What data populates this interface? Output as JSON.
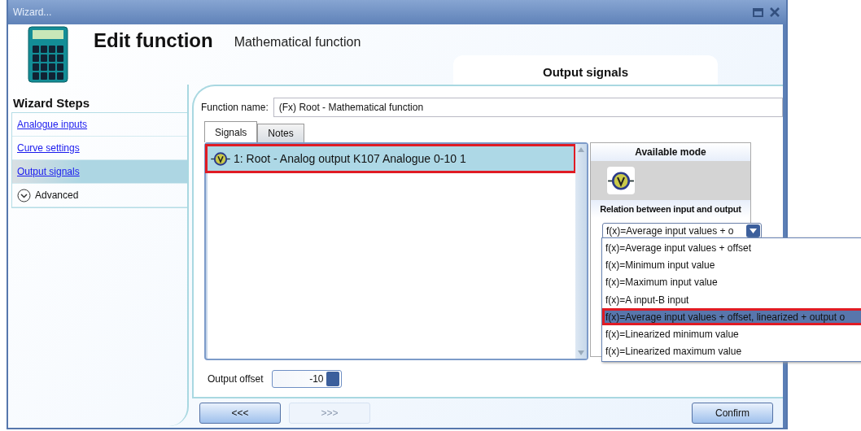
{
  "window": {
    "title": "Wizard..."
  },
  "header": {
    "title": "Edit function",
    "subtitle": "Mathematical function"
  },
  "step_tab": {
    "label": "Output signals"
  },
  "sidebar": {
    "title": "Wizard Steps",
    "items": [
      {
        "label": "Analogue inputs",
        "kind": "link",
        "selected": false
      },
      {
        "label": "Curve settings",
        "kind": "link",
        "selected": false
      },
      {
        "label": "Output signals",
        "kind": "link",
        "selected": true
      },
      {
        "label": "Advanced",
        "kind": "expander",
        "selected": false
      }
    ]
  },
  "function_name": {
    "label": "Function name:",
    "value": "(Fx) Root - Mathematical function"
  },
  "tabs": [
    {
      "label": "Signals",
      "selected": true
    },
    {
      "label": "Notes",
      "selected": false
    }
  ],
  "signals": [
    {
      "label": "1: Root - Analog output K107 Analogue 0-10 1",
      "selected": true,
      "highlighted": true
    }
  ],
  "mode_panel": {
    "title": "Available mode",
    "relation_label": "Relation between input and output",
    "dropdown": {
      "value": "f(x)=Average input values + o",
      "expanded": true,
      "options": [
        {
          "label": "f(x)=Average input values + offset",
          "selected": false,
          "highlighted": false
        },
        {
          "label": "f(x)=Minimum input value",
          "selected": false,
          "highlighted": false
        },
        {
          "label": "f(x)=Maximum input value",
          "selected": false,
          "highlighted": false
        },
        {
          "label": "f(x)=A input-B input",
          "selected": false,
          "highlighted": false
        },
        {
          "label": "f(x)=Average input values + offset, linearized + output o",
          "selected": true,
          "highlighted": true
        },
        {
          "label": "f(x)=Linearized minimum  value",
          "selected": false,
          "highlighted": false
        },
        {
          "label": "f(x)=Linearized maximum  value",
          "selected": false,
          "highlighted": false
        }
      ]
    }
  },
  "output_offset": {
    "label": "Output offset",
    "value": "-10"
  },
  "buttons": [
    {
      "label": "<<<",
      "disabled": false
    },
    {
      "label": ">>>",
      "disabled": true
    },
    {
      "label": "Confirm",
      "disabled": false
    }
  ]
}
